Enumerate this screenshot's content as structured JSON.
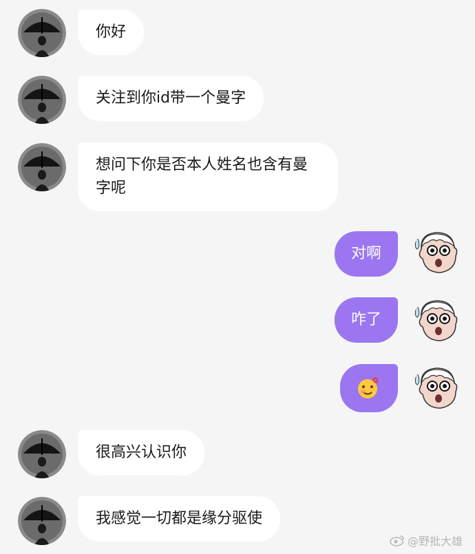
{
  "chat": {
    "messages": [
      {
        "side": "left",
        "text": "你好"
      },
      {
        "side": "left",
        "text": "关注到你id带一个曼字"
      },
      {
        "side": "left",
        "text": "想问下你是否本人姓名也含有曼字呢"
      },
      {
        "side": "right",
        "text": "对啊"
      },
      {
        "side": "right",
        "text": "咋了"
      },
      {
        "side": "right",
        "text": "",
        "emoji": "dizzy-face-emoji"
      },
      {
        "side": "left",
        "text": "很高兴认识你"
      },
      {
        "side": "left",
        "text": "我感觉一切都是缘分驱使"
      }
    ]
  },
  "watermark": {
    "text": "@野批大雄",
    "icon": "weibo-icon"
  },
  "colors": {
    "outgoing_bubble": "#9b76f0",
    "incoming_bubble": "#ffffff",
    "background": "#f5f5f5"
  }
}
